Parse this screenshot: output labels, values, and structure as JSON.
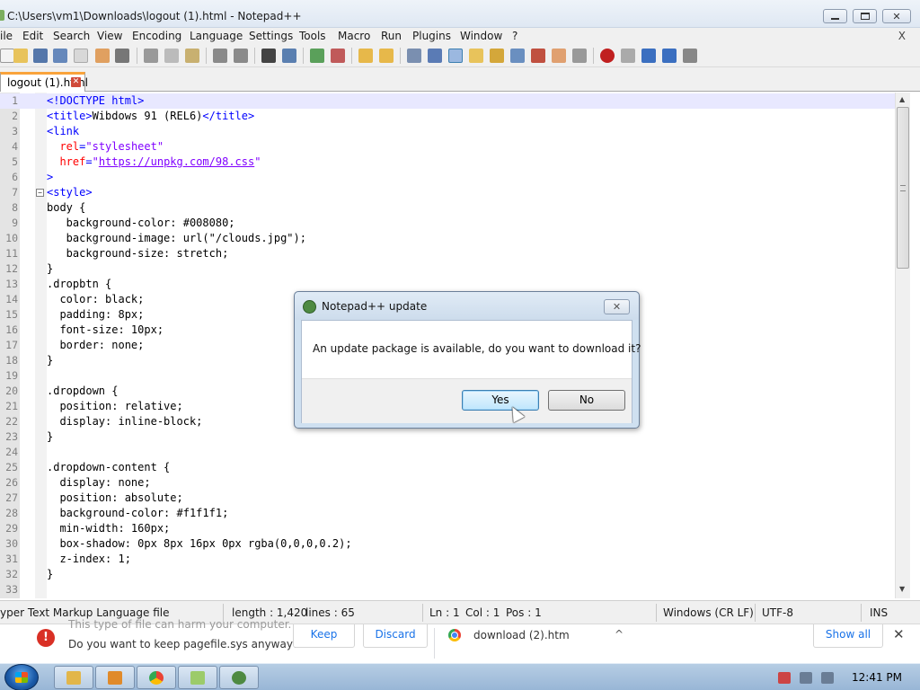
{
  "window": {
    "title": "C:\\Users\\vm1\\Downloads\\logout (1).html - Notepad++"
  },
  "menu": {
    "items": [
      "ile",
      "Edit",
      "Search",
      "View",
      "Encoding",
      "Language",
      "Settings",
      "Tools",
      "Macro",
      "Run",
      "Plugins",
      "Window",
      "?"
    ],
    "close_label": "X"
  },
  "tabs": [
    {
      "label": "logout (1).html",
      "close": "✕"
    }
  ],
  "editor": {
    "lines": [
      [
        {
          "t": "tag",
          "v": "<!DOCTYPE html>"
        }
      ],
      [
        {
          "t": "tag",
          "v": "<title>"
        },
        {
          "t": "text",
          "v": "Wibdows 91 (REL6)"
        },
        {
          "t": "tag",
          "v": "</title>"
        }
      ],
      [
        {
          "t": "tag",
          "v": "<link"
        }
      ],
      [
        {
          "t": "text",
          "v": "  "
        },
        {
          "t": "attr",
          "v": "rel"
        },
        {
          "t": "tag",
          "v": "="
        },
        {
          "t": "str",
          "v": "\"stylesheet\""
        }
      ],
      [
        {
          "t": "text",
          "v": "  "
        },
        {
          "t": "attr",
          "v": "href"
        },
        {
          "t": "tag",
          "v": "="
        },
        {
          "t": "str",
          "v": "\""
        },
        {
          "t": "url",
          "v": "https://unpkg.com/98.css"
        },
        {
          "t": "str",
          "v": "\""
        }
      ],
      [
        {
          "t": "tag",
          "v": ">"
        }
      ],
      [
        {
          "t": "tag",
          "v": "<style>"
        }
      ],
      [
        {
          "t": "css",
          "v": "body {"
        }
      ],
      [
        {
          "t": "css",
          "v": "   background-color: #008080;"
        }
      ],
      [
        {
          "t": "css",
          "v": "   background-image: url(\"/clouds.jpg\");"
        }
      ],
      [
        {
          "t": "css",
          "v": "   background-size: stretch;"
        }
      ],
      [
        {
          "t": "css",
          "v": "}"
        }
      ],
      [
        {
          "t": "css",
          "v": ".dropbtn {"
        }
      ],
      [
        {
          "t": "css",
          "v": "  color: black;"
        }
      ],
      [
        {
          "t": "css",
          "v": "  padding: 8px;"
        }
      ],
      [
        {
          "t": "css",
          "v": "  font-size: 10px;"
        }
      ],
      [
        {
          "t": "css",
          "v": "  border: none;"
        }
      ],
      [
        {
          "t": "css",
          "v": "}"
        }
      ],
      [
        {
          "t": "css",
          "v": ""
        }
      ],
      [
        {
          "t": "css",
          "v": ".dropdown {"
        }
      ],
      [
        {
          "t": "css",
          "v": "  position: relative;"
        }
      ],
      [
        {
          "t": "css",
          "v": "  display: inline-block;"
        }
      ],
      [
        {
          "t": "css",
          "v": "}"
        }
      ],
      [
        {
          "t": "css",
          "v": ""
        }
      ],
      [
        {
          "t": "css",
          "v": ".dropdown-content {"
        }
      ],
      [
        {
          "t": "css",
          "v": "  display: none;"
        }
      ],
      [
        {
          "t": "css",
          "v": "  position: absolute;"
        }
      ],
      [
        {
          "t": "css",
          "v": "  background-color: #f1f1f1;"
        }
      ],
      [
        {
          "t": "css",
          "v": "  min-width: 160px;"
        }
      ],
      [
        {
          "t": "css",
          "v": "  box-shadow: 0px 8px 16px 0px rgba(0,0,0,0.2);"
        }
      ],
      [
        {
          "t": "css",
          "v": "  z-index: 1;"
        }
      ],
      [
        {
          "t": "css",
          "v": "}"
        }
      ],
      [
        {
          "t": "css",
          "v": ""
        }
      ]
    ],
    "current_line": 1,
    "fold_line": 7,
    "fold_glyph": "−"
  },
  "status": {
    "file_type": "yper Text Markup Language file",
    "length": "length : 1,420",
    "lines": "lines : 65",
    "ln": "Ln : 1",
    "col": "Col : 1",
    "pos": "Pos : 1",
    "eol": "Windows (CR LF)",
    "encoding": "UTF-8",
    "mode": "INS"
  },
  "download_bar": {
    "faded_text": "This type of file can harm your computer.",
    "question": "Do you want to keep pagefile.sys anyway?",
    "keep": "Keep",
    "discard": "Discard",
    "file": "download (2).htm",
    "show_all": "Show all",
    "close": "✕",
    "chevron": "^"
  },
  "dialog": {
    "title": "Notepad++ update",
    "message": "An update package is available, do you want to download it?",
    "yes": "Yes",
    "no": "No",
    "close": "✕"
  },
  "taskbar": {
    "clock": "12:41 PM"
  },
  "colors": {
    "tag": "#0000ff",
    "attribute": "#ff0000",
    "string": "#8000ff",
    "tab_accent": "#f9a33b"
  }
}
